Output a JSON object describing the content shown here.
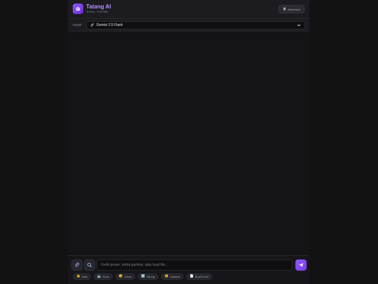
{
  "header": {
    "title": "Tatang AI",
    "subtitle": "10 Key · Full Fitur",
    "clear_label": "Bersihkan",
    "logo_icon": "robot-icon",
    "clear_icon": "trash-icon"
  },
  "model_bar": {
    "label": "Model:",
    "selected": "Gemini 2.5 Flash",
    "selected_icon": "rocket-icon"
  },
  "composer": {
    "placeholder": "Ketik pesan, minta gambar, atau buat file...",
    "attach_icon": "paperclip-icon",
    "search_icon": "search-icon",
    "send_icon": "send-icon"
  },
  "quick_actions": [
    {
      "label": "Halo",
      "icon": "wave-icon"
    },
    {
      "label": "Kode",
      "icon": "laptop-icon"
    },
    {
      "label": "Jokes",
      "icon": "laugh-icon"
    },
    {
      "label": "Hitung",
      "icon": "calculator-icon"
    },
    {
      "label": "Gambar",
      "icon": "cat-icon"
    },
    {
      "label": "Buat Excel",
      "icon": "document-icon"
    }
  ],
  "colors": {
    "accent": "#8b5cf6",
    "title": "#b494ff",
    "background": "#121212",
    "surface": "#1b1b20"
  }
}
